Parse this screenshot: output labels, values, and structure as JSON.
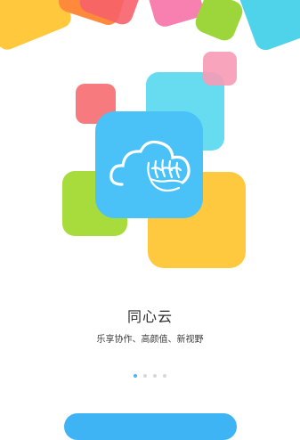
{
  "app": {
    "title": "同心云",
    "subtitle": "乐享协作、高颜值、新视野"
  },
  "pager": {
    "pages": 4,
    "current": 1
  },
  "icons": {
    "logo": "cloud-with-hands-icon"
  },
  "colors": {
    "blue_tile": "#4ac1f7",
    "cyan_tile": "#5ad8ee",
    "yellow_tile": "#ffc93f",
    "green_tile": "#a8dc3c",
    "red_tile": "#f77a7f",
    "pink_tile": "#f89ab6",
    "orange_tile": "#ff8a3b",
    "active_dot": "#4bb4f3",
    "inactive_dot": "#d7d7d7"
  },
  "start_button": {
    "label": ""
  }
}
